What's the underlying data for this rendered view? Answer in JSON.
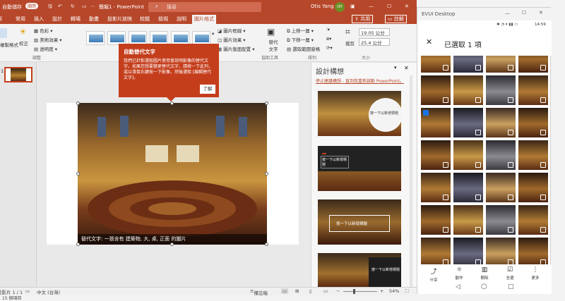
{
  "ppt": {
    "autosave": "自動儲存",
    "autosave_state": "關閉",
    "doc_title": "簡報1 - PowerPoint",
    "search_placeholder": "搜尋",
    "user": "Otis Yang",
    "user_initials": "OY",
    "share": "共用",
    "comments": "註解",
    "tabs": [
      "常用",
      "插入",
      "設計",
      "轉場",
      "動畫",
      "投影片放映",
      "校閱",
      "檢視",
      "說明",
      "圖片格式"
    ],
    "ribbon": {
      "format_painter": "複製格式",
      "correct": "校正",
      "color": "色彩",
      "artistic": "美術效果",
      "transparency": "透明度",
      "adjust_group": "調整",
      "border": "圖片框線",
      "effects": "圖片效果",
      "layout": "圖片版面配置",
      "alt_text": "替代文字",
      "accessibility_group": "協助工具",
      "bring_forward": "上移一層",
      "send_backward": "下移一層",
      "selection_pane": "選取範圍窗格",
      "arrange_group": "排列",
      "crop": "裁剪",
      "height": "19.05 公分",
      "width": "25.4 公分",
      "size_group": "大小"
    },
    "tooltip": {
      "title": "自動替代文字",
      "body": "我們已針對選取圖片使用會說明影像的替代文字。如果您想要變更替代文字，請按一下此列，或以滑鼠右鍵按一下影像，然後選取 [編輯替代文字]。",
      "button": "了解"
    },
    "slide_number": "1",
    "caption": "替代文字: 一張含有 建築物, 大, 桌, 正面 的圖片",
    "designer": {
      "title": "設計構想",
      "link": "停止建議構想 - 直到我重新啟動 PowerPoint。",
      "ideas": [
        "按一下以新增標題",
        "按一下以新增標題",
        "按一下以新增標題",
        "按一下以新增標題"
      ]
    },
    "status": {
      "slide": "投影片 1 / 1",
      "lang": "中文 (台灣)",
      "notes": "備忘稿",
      "zoom": "54%"
    },
    "taskbar_text": "15 個項目"
  },
  "phone": {
    "window_title": "EVUI Desktop",
    "time": "14:59",
    "header": "已選取 1 項",
    "actions": [
      "分享",
      "動作",
      "刪除",
      "全選",
      "更多"
    ]
  },
  "colors": {
    "ppt_accent": "#b7472a",
    "tooltip": "#c43e1c",
    "check": "#1a73e8"
  }
}
